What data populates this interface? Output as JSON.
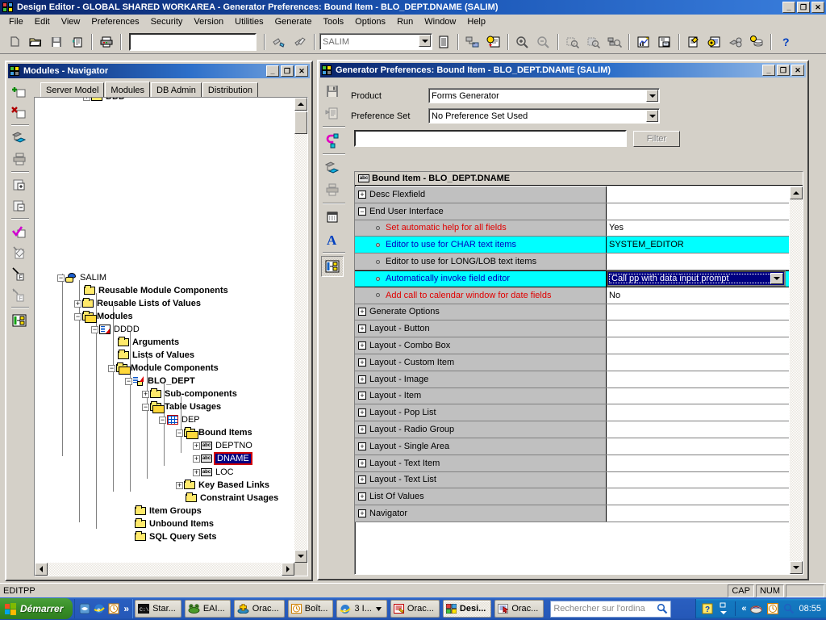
{
  "app": {
    "title": "Design Editor - GLOBAL SHARED WORKAREA - Generator Preferences:  Bound Item - BLO_DEPT.DNAME (SALIM)",
    "icon": "design-editor-icon",
    "window_buttons": {
      "minimize": "_",
      "restore": "❐",
      "close": "✕"
    },
    "menu": [
      "File",
      "Edit",
      "View",
      "Preferences",
      "Security",
      "Version",
      "Utilities",
      "Generate",
      "Tools",
      "Options",
      "Run",
      "Window",
      "Help"
    ],
    "toolbar": {
      "search_value": "",
      "workarea_value": "SALIM",
      "icons": [
        "new-icon",
        "open-folder-icon",
        "save-icon",
        "save-all-icon",
        "print-icon",
        "check-in-icon",
        "check-out-icon",
        "workarea-list-icon",
        "server-model-icon",
        "generate-icon",
        "zoom-in-icon",
        "zoom-out-icon",
        "find-icon",
        "find-next-icon",
        "find-usage-icon",
        "matrix-diagram-icon",
        "properties-icon",
        "edit-module-icon",
        "preferences-icon",
        "module-structure-icon",
        "table-definition-icon",
        "database-objects-icon",
        "help-icon"
      ]
    }
  },
  "navigator": {
    "title": "Modules - Navigator",
    "icon": "navigator-icon",
    "window_buttons": {
      "minimize": "_",
      "restore": "❐",
      "close": "✕"
    },
    "tools": [
      "create-icon",
      "delete-icon",
      "properties-icon",
      "print-icon",
      "expand-icon",
      "collapse-icon",
      "mark-icon",
      "edit-icon",
      "down-icon",
      "up-icon",
      "module-diagram-icon"
    ],
    "tabs": [
      {
        "label": "Server Model",
        "active": false
      },
      {
        "label": "Modules",
        "active": true
      },
      {
        "label": "DB Admin",
        "active": false
      },
      {
        "label": "Distribution",
        "active": false
      }
    ],
    "tree": [
      {
        "label": "SALIM",
        "indent": 0,
        "expander": "-",
        "icon": "salim-workarea-icon",
        "bold": false,
        "selected": false
      },
      {
        "label": "Reusable Module Components",
        "indent": 1,
        "expander": "",
        "icon": "folder-closed-icon",
        "bold": true,
        "selected": false
      },
      {
        "label": "Reusable Lists of Values",
        "indent": 1,
        "expander": "+",
        "icon": "folder-closed-icon",
        "bold": true,
        "selected": false
      },
      {
        "label": "Modules",
        "indent": 1,
        "expander": "-",
        "icon": "folder-open-icon",
        "bold": true,
        "selected": false
      },
      {
        "label": "DDDD",
        "indent": 2,
        "expander": "-",
        "icon": "module-icon",
        "bold": false,
        "selected": false
      },
      {
        "label": "Arguments",
        "indent": 3,
        "expander": "",
        "icon": "folder-closed-icon",
        "bold": true,
        "selected": false
      },
      {
        "label": "Lists of Values",
        "indent": 3,
        "expander": "",
        "icon": "folder-closed-icon",
        "bold": true,
        "selected": false
      },
      {
        "label": "Module Components",
        "indent": 3,
        "expander": "-",
        "icon": "folder-open-icon",
        "bold": true,
        "selected": false
      },
      {
        "label": "BLO_DEPT",
        "indent": 4,
        "expander": "-",
        "icon": "module-component-icon",
        "bold": true,
        "selected": false
      },
      {
        "label": "Sub-components",
        "indent": 5,
        "expander": "+",
        "icon": "folder-closed-icon",
        "bold": true,
        "selected": false
      },
      {
        "label": "Table Usages",
        "indent": 5,
        "expander": "-",
        "icon": "folder-open-icon",
        "bold": true,
        "selected": false
      },
      {
        "label": "DEP",
        "indent": 6,
        "expander": "-",
        "icon": "table-usage-icon",
        "bold": false,
        "selected": false
      },
      {
        "label": "Bound Items",
        "indent": 7,
        "expander": "-",
        "icon": "folder-open-icon",
        "bold": true,
        "selected": false
      },
      {
        "label": "DEPTNO",
        "indent": 8,
        "expander": "+",
        "icon": "abc-item-icon",
        "bold": false,
        "selected": false
      },
      {
        "label": "DNAME",
        "indent": 8,
        "expander": "+",
        "icon": "abc-item-icon",
        "bold": false,
        "selected": true
      },
      {
        "label": "LOC",
        "indent": 8,
        "expander": "+",
        "icon": "abc-item-icon",
        "bold": false,
        "selected": false
      },
      {
        "label": "Key Based Links",
        "indent": 7,
        "expander": "+",
        "icon": "folder-closed-icon",
        "bold": true,
        "selected": false
      },
      {
        "label": "Constraint Usages",
        "indent": 7,
        "expander": "",
        "icon": "folder-closed-icon",
        "bold": true,
        "selected": false
      },
      {
        "label": "Item Groups",
        "indent": 4,
        "expander": "",
        "icon": "folder-closed-icon",
        "bold": true,
        "selected": false
      },
      {
        "label": "Unbound Items",
        "indent": 4,
        "expander": "",
        "icon": "folder-closed-icon",
        "bold": true,
        "selected": false
      },
      {
        "label": "SQL Query Sets",
        "indent": 4,
        "expander": "",
        "icon": "folder-closed-icon",
        "bold": true,
        "selected": false
      }
    ]
  },
  "generator_preferences": {
    "title": "Generator Preferences: Bound Item - BLO_DEPT.DNAME (SALIM)",
    "icon": "generator-preferences-icon",
    "window_buttons": {
      "minimize": "_",
      "restore": "❐",
      "close": "✕"
    },
    "tools": [
      "save-icon",
      "copy-icon",
      "reset-icon",
      "hierarchy-icon",
      "print-icon",
      "list-icon",
      "font-icon",
      "module-structure-icon"
    ],
    "product": {
      "label": "Product",
      "value": "Forms Generator"
    },
    "preference_set": {
      "label": "Preference Set",
      "value": "No Preference Set Used"
    },
    "filter": {
      "value": "",
      "button_label": "Filter"
    },
    "grid_header": {
      "label": "Bound Item - BLO_DEPT.DNAME",
      "icon": "abc-item-icon"
    },
    "rows": [
      {
        "name": "Desc Flexfield",
        "value": "",
        "expander": "+",
        "level": 0,
        "color": "black",
        "highlight": false,
        "selected": false
      },
      {
        "name": "End User Interface",
        "value": "",
        "expander": "-",
        "level": 0,
        "color": "black",
        "highlight": false,
        "selected": false
      },
      {
        "name": "Set automatic help for all fields",
        "value": "Yes",
        "expander": "dot",
        "level": 1,
        "color": "red",
        "highlight": false,
        "selected": false
      },
      {
        "name": "Editor to use for CHAR text items",
        "value": "SYSTEM_EDITOR",
        "expander": "dot",
        "level": 1,
        "color": "blue",
        "highlight": true,
        "selected": false
      },
      {
        "name": "Editor to use for LONG/LOB text items",
        "value": "",
        "expander": "dot",
        "level": 1,
        "color": "black",
        "highlight": false,
        "selected": false
      },
      {
        "name": "Automatically invoke field editor",
        "value": "Call pp with data input prompt",
        "expander": "dot",
        "level": 1,
        "color": "blue",
        "highlight": true,
        "selected": true
      },
      {
        "name": "Add call to calendar window for date fields",
        "value": "No",
        "expander": "dot",
        "level": 1,
        "color": "red",
        "highlight": false,
        "selected": false
      },
      {
        "name": "Generate Options",
        "value": "",
        "expander": "+",
        "level": 0,
        "color": "black",
        "highlight": false,
        "selected": false
      },
      {
        "name": "Layout - Button",
        "value": "",
        "expander": "+",
        "level": 0,
        "color": "black",
        "highlight": false,
        "selected": false
      },
      {
        "name": "Layout - Combo Box",
        "value": "",
        "expander": "+",
        "level": 0,
        "color": "black",
        "highlight": false,
        "selected": false
      },
      {
        "name": "Layout - Custom Item",
        "value": "",
        "expander": "+",
        "level": 0,
        "color": "black",
        "highlight": false,
        "selected": false
      },
      {
        "name": "Layout - Image",
        "value": "",
        "expander": "+",
        "level": 0,
        "color": "black",
        "highlight": false,
        "selected": false
      },
      {
        "name": "Layout - Item",
        "value": "",
        "expander": "+",
        "level": 0,
        "color": "black",
        "highlight": false,
        "selected": false
      },
      {
        "name": "Layout - Pop List",
        "value": "",
        "expander": "+",
        "level": 0,
        "color": "black",
        "highlight": false,
        "selected": false
      },
      {
        "name": "Layout - Radio Group",
        "value": "",
        "expander": "+",
        "level": 0,
        "color": "black",
        "highlight": false,
        "selected": false
      },
      {
        "name": "Layout - Single Area",
        "value": "",
        "expander": "+",
        "level": 0,
        "color": "black",
        "highlight": false,
        "selected": false
      },
      {
        "name": "Layout - Text Item",
        "value": "",
        "expander": "+",
        "level": 0,
        "color": "black",
        "highlight": false,
        "selected": false
      },
      {
        "name": "Layout - Text List",
        "value": "",
        "expander": "+",
        "level": 0,
        "color": "black",
        "highlight": false,
        "selected": false
      },
      {
        "name": "List Of Values",
        "value": "",
        "expander": "+",
        "level": 0,
        "color": "black",
        "highlight": false,
        "selected": false
      },
      {
        "name": "Navigator",
        "value": "",
        "expander": "+",
        "level": 0,
        "color": "black",
        "highlight": false,
        "selected": false
      }
    ]
  },
  "statusbar": {
    "message": "EDITPP",
    "cap": "CAP",
    "num": "NUM",
    "extra": ""
  },
  "taskbar": {
    "start_label": "Démarrer",
    "quicklaunch": [
      "ie-desktop-icon",
      "internet-explorer-icon",
      "clock-icon"
    ],
    "chevron": "»",
    "items": [
      {
        "label": "Star...",
        "icon": "console-icon",
        "active": false,
        "dropdown": false
      },
      {
        "label": "EAI...",
        "icon": "frog-icon",
        "active": false,
        "dropdown": false
      },
      {
        "label": "Orac...",
        "icon": "oracle-plus-icon",
        "active": false,
        "dropdown": false
      },
      {
        "label": "Boît...",
        "icon": "clock-icon",
        "active": false,
        "dropdown": false
      },
      {
        "label": "3 I...",
        "icon": "internet-explorer-icon",
        "active": false,
        "dropdown": true
      },
      {
        "label": "Orac...",
        "icon": "oracle-red-icon",
        "active": false,
        "dropdown": false
      },
      {
        "label": "Desi...",
        "icon": "design-editor-icon",
        "active": true,
        "dropdown": false
      },
      {
        "label": "Orac...",
        "icon": "oracle-nav-icon",
        "active": false,
        "dropdown": false
      }
    ],
    "search_placeholder": "Rechercher sur l'ordina",
    "tray": {
      "icons": [
        "help-icon",
        "network-icon",
        "volume-icon",
        "clock-icon",
        "search-icon"
      ],
      "clock": "08:55"
    }
  },
  "colors": {
    "highlight_cyan": "#00ffff",
    "selection_navy": "#000080",
    "red_text": "#e00000",
    "blue_text": "#0000c0",
    "face": "#d4d0c8",
    "title_blue": "#0a246a"
  }
}
